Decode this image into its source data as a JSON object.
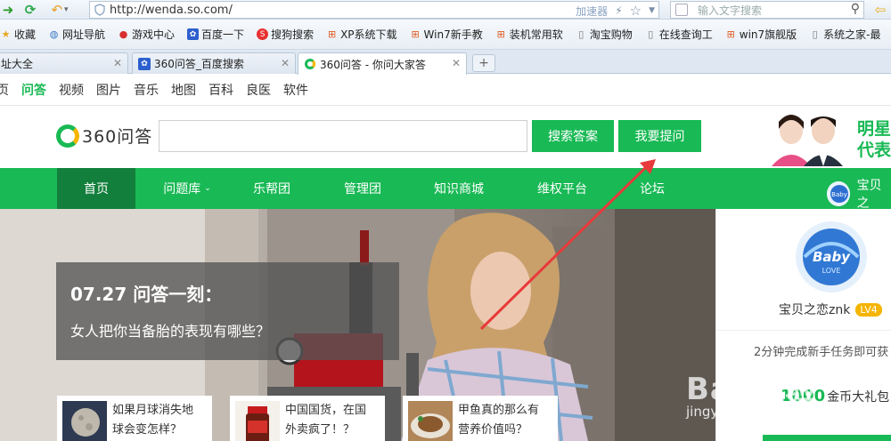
{
  "browser": {
    "url": "http://wenda.so.com/",
    "accelerator_label": "加速器",
    "search_placeholder": "输入文字搜索"
  },
  "favorites": [
    {
      "label": "收藏",
      "icon": "star-icon"
    },
    {
      "label": "网址导航",
      "icon": "globe-icon"
    },
    {
      "label": "游戏中心",
      "icon": "game-icon"
    },
    {
      "label": "百度一下",
      "icon": "baidu-paw-icon"
    },
    {
      "label": "搜狗搜索",
      "icon": "sogou-icon"
    },
    {
      "label": "XP系统下载",
      "icon": "windows-icon"
    },
    {
      "label": "Win7新手教",
      "icon": "windows-icon"
    },
    {
      "label": "装机常用软",
      "icon": "windows-icon"
    },
    {
      "label": "淘宝购物",
      "icon": "page-icon"
    },
    {
      "label": "在线查询工",
      "icon": "page-icon"
    },
    {
      "label": "win7旗舰版",
      "icon": "windows-icon"
    },
    {
      "label": "系统之家-最",
      "icon": "page-icon"
    }
  ],
  "tabs": [
    {
      "label": "址大全",
      "icon": "",
      "active": false
    },
    {
      "label": "360问答_百度搜索",
      "icon": "baidu-paw-icon",
      "active": false
    },
    {
      "label": "360问答 - 你问大家答",
      "icon": "360-logo-icon",
      "active": true
    }
  ],
  "channels": [
    "页",
    "问答",
    "视频",
    "图片",
    "音乐",
    "地图",
    "百科",
    "良医",
    "软件"
  ],
  "active_channel": "问答",
  "header": {
    "logo_text": "360问答",
    "search_button": "搜索答案",
    "ask_button": "我要提问",
    "promo_text_line1": "明星",
    "promo_text_line2": "代表"
  },
  "menu": {
    "items": [
      "首页",
      "问题库",
      "乐帮团",
      "管理团",
      "知识商城",
      "维权平台",
      "论坛"
    ],
    "active": "首页",
    "user_name": "宝贝之"
  },
  "hero": {
    "title": "07.27 问答一刻：",
    "subtitle": "女人把你当备胎的表现有哪些？",
    "cards": [
      {
        "line1": "如果月球消失地",
        "line2": "球会变怎样？"
      },
      {
        "line1": "中国国货，在国",
        "line2": "外卖疯了！？"
      },
      {
        "line1": "甲鱼真的那么有",
        "line2": "营养价值吗？"
      }
    ]
  },
  "panel": {
    "user_name": "宝贝之恋znk",
    "level": "LV4",
    "task_text": "2分钟完成新手任务即可获",
    "coin_amount": "1000",
    "coin_text": "金币大礼包"
  },
  "watermark": {
    "text": "Bai 经验",
    "sub": "jingyan.baidu.com"
  },
  "colors": {
    "brand_green": "#19b955",
    "menu_active": "#127f3c",
    "arrow_red": "#e83a3a"
  }
}
